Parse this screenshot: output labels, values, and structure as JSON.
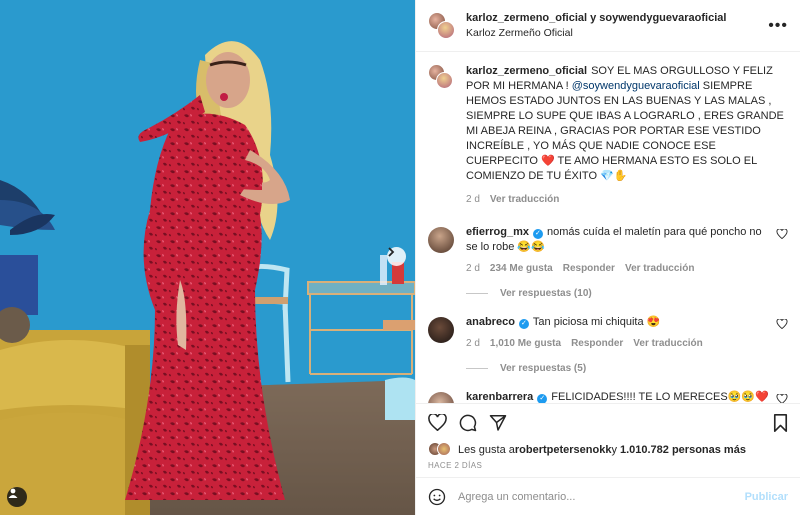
{
  "header": {
    "usernames": "karloz_zermeno_oficial y soywendyguevaraoficial",
    "subtitle": "Karloz Zermeño Oficial"
  },
  "caption": {
    "username": "karloz_zermeno_oficial",
    "text_1": "SOY EL MAS ORGULLOSO Y FELIZ POR MI HERMANA ! ",
    "mention": "@soywendyguevaraoficial",
    "text_2": " SIEMPRE HEMOS ESTADO JUNTOS EN LAS BUENAS Y LAS MALAS , SIEMPRE LO SUPE QUE IBAS A LOGRARLO , ERES GRANDE MI ABEJA REINA , GRACIAS POR PORTAR ESE VESTIDO INCREÍBLE , YO MÁS QUE NADIE CONOCE ESE CUERPECITO ❤️ TE AMO HERMANA ESTO ES SOLO EL COMIENZO DE TU ÉXITO 💎✋",
    "time": "2 d",
    "translate": "Ver traducción"
  },
  "comments": [
    {
      "username": "efierrog_mx",
      "verified": true,
      "text": "nomás cuída el maletín para qué poncho no se lo robe 😂😂",
      "time": "2 d",
      "likes": "234 Me gusta",
      "reply": "Responder",
      "translate": "Ver traducción",
      "replies": "Ver respuestas (10)"
    },
    {
      "username": "anabreco",
      "verified": true,
      "text": "Tan piciosa mi chiquita 😍",
      "time": "2 d",
      "likes": "1,010 Me gusta",
      "reply": "Responder",
      "translate": "Ver traducción",
      "replies": "Ver respuestas (5)"
    },
    {
      "username": "karenbarrera",
      "verified": true,
      "text": "FELICIDADES!!!! TE LO MERECES🥹🥹❤️❤️"
    }
  ],
  "likes": {
    "prefix": "Les gusta a ",
    "user": "robertpetersenokk",
    "middle": " y ",
    "count": "1.010.782 personas más"
  },
  "time_ago": "HACE 2 DÍAS",
  "comment_box": {
    "placeholder": "Agrega un comentario...",
    "post_label": "Publicar"
  },
  "colors": {
    "wall": "#2fa0d4",
    "dress": "#c8213a",
    "verified": "#1d9bf0",
    "post_button": "#b2dffc"
  }
}
